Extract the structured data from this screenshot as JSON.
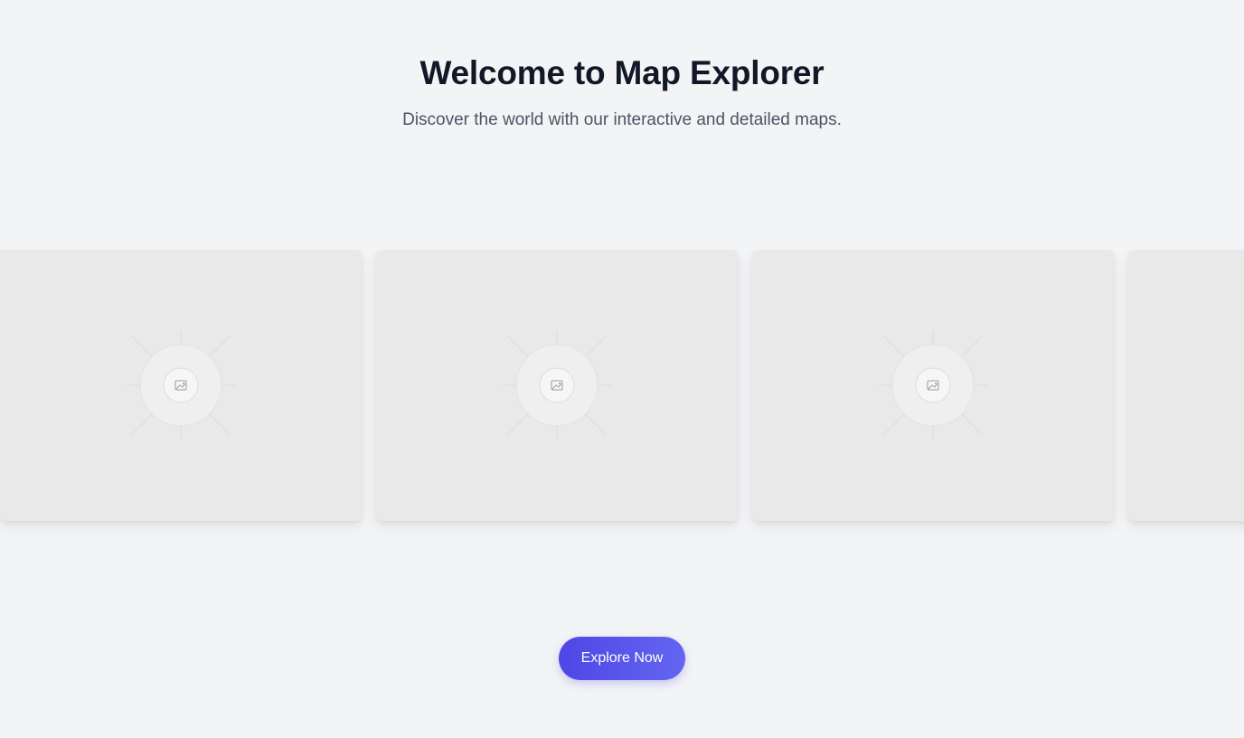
{
  "hero": {
    "title": "Welcome to Map Explorer",
    "subtitle": "Discover the world with our interactive and detailed maps."
  },
  "carousel": {
    "cards": [
      {
        "icon": "image-placeholder-icon"
      },
      {
        "icon": "image-placeholder-icon"
      },
      {
        "icon": "image-placeholder-icon"
      },
      {
        "icon": "image-placeholder-icon"
      }
    ]
  },
  "cta": {
    "label": "Explore Now"
  },
  "colors": {
    "background": "#f3f4f6",
    "title": "#111827",
    "subtitle": "#4b5563",
    "card": "#e9e9e9",
    "button_start": "#4f46e5",
    "button_end": "#6366f1"
  }
}
